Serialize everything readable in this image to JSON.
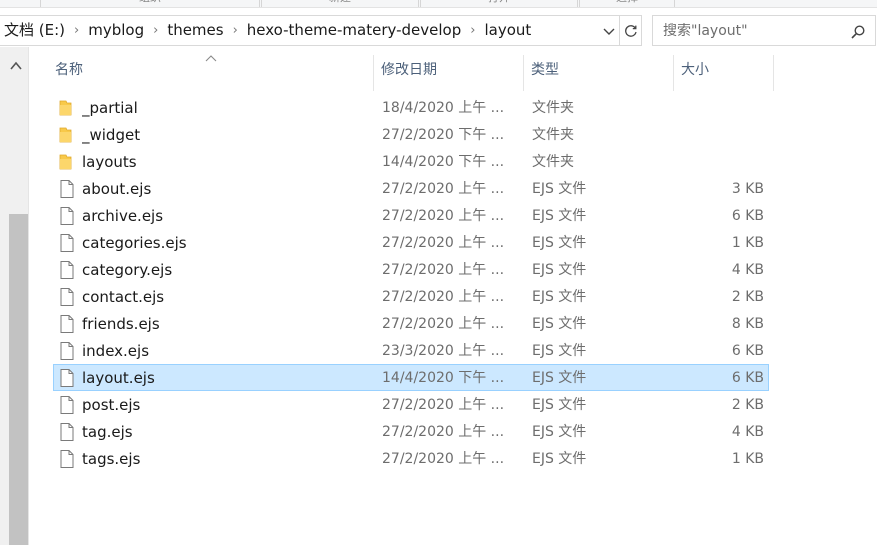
{
  "ribbon": {
    "groups": [
      "组织",
      "新建",
      "打开",
      "选择"
    ]
  },
  "address": {
    "crumbs": [
      "文档 (E:)",
      "myblog",
      "themes",
      "hexo-theme-matery-develop",
      "layout"
    ]
  },
  "search": {
    "placeholder": "搜索\"layout\""
  },
  "columns": {
    "name": "名称",
    "date": "修改日期",
    "type": "类型",
    "size": "大小"
  },
  "files": [
    {
      "name": "_partial",
      "date": "18/4/2020 上午 ...",
      "type": "文件夹",
      "size": "",
      "kind": "folder-icon"
    },
    {
      "name": "_widget",
      "date": "27/2/2020 下午 ...",
      "type": "文件夹",
      "size": "",
      "kind": "folder-icon"
    },
    {
      "name": "layouts",
      "date": "14/4/2020 下午 ...",
      "type": "文件夹",
      "size": "",
      "kind": "folder-icon"
    },
    {
      "name": "about.ejs",
      "date": "27/2/2020 上午 ...",
      "type": "EJS 文件",
      "size": "3 KB",
      "kind": "file-icon"
    },
    {
      "name": "archive.ejs",
      "date": "27/2/2020 上午 ...",
      "type": "EJS 文件",
      "size": "6 KB",
      "kind": "file-icon"
    },
    {
      "name": "categories.ejs",
      "date": "27/2/2020 上午 ...",
      "type": "EJS 文件",
      "size": "1 KB",
      "kind": "file-icon"
    },
    {
      "name": "category.ejs",
      "date": "27/2/2020 上午 ...",
      "type": "EJS 文件",
      "size": "4 KB",
      "kind": "file-icon"
    },
    {
      "name": "contact.ejs",
      "date": "27/2/2020 上午 ...",
      "type": "EJS 文件",
      "size": "2 KB",
      "kind": "file-icon"
    },
    {
      "name": "friends.ejs",
      "date": "27/2/2020 上午 ...",
      "type": "EJS 文件",
      "size": "8 KB",
      "kind": "file-icon"
    },
    {
      "name": "index.ejs",
      "date": "23/3/2020 上午 ...",
      "type": "EJS 文件",
      "size": "6 KB",
      "kind": "file-icon"
    },
    {
      "name": "layout.ejs",
      "date": "14/4/2020 下午 ...",
      "type": "EJS 文件",
      "size": "6 KB",
      "kind": "file-icon",
      "selected": true
    },
    {
      "name": "post.ejs",
      "date": "27/2/2020 上午 ...",
      "type": "EJS 文件",
      "size": "2 KB",
      "kind": "file-icon"
    },
    {
      "name": "tag.ejs",
      "date": "27/2/2020 上午 ...",
      "type": "EJS 文件",
      "size": "4 KB",
      "kind": "file-icon"
    },
    {
      "name": "tags.ejs",
      "date": "27/2/2020 上午 ...",
      "type": "EJS 文件",
      "size": "1 KB",
      "kind": "file-icon"
    }
  ],
  "colors": {
    "selection_bg": "#cce8ff",
    "selection_border": "#99d1ff",
    "folder": "#f8c94a",
    "header_text": "#4c607a"
  }
}
